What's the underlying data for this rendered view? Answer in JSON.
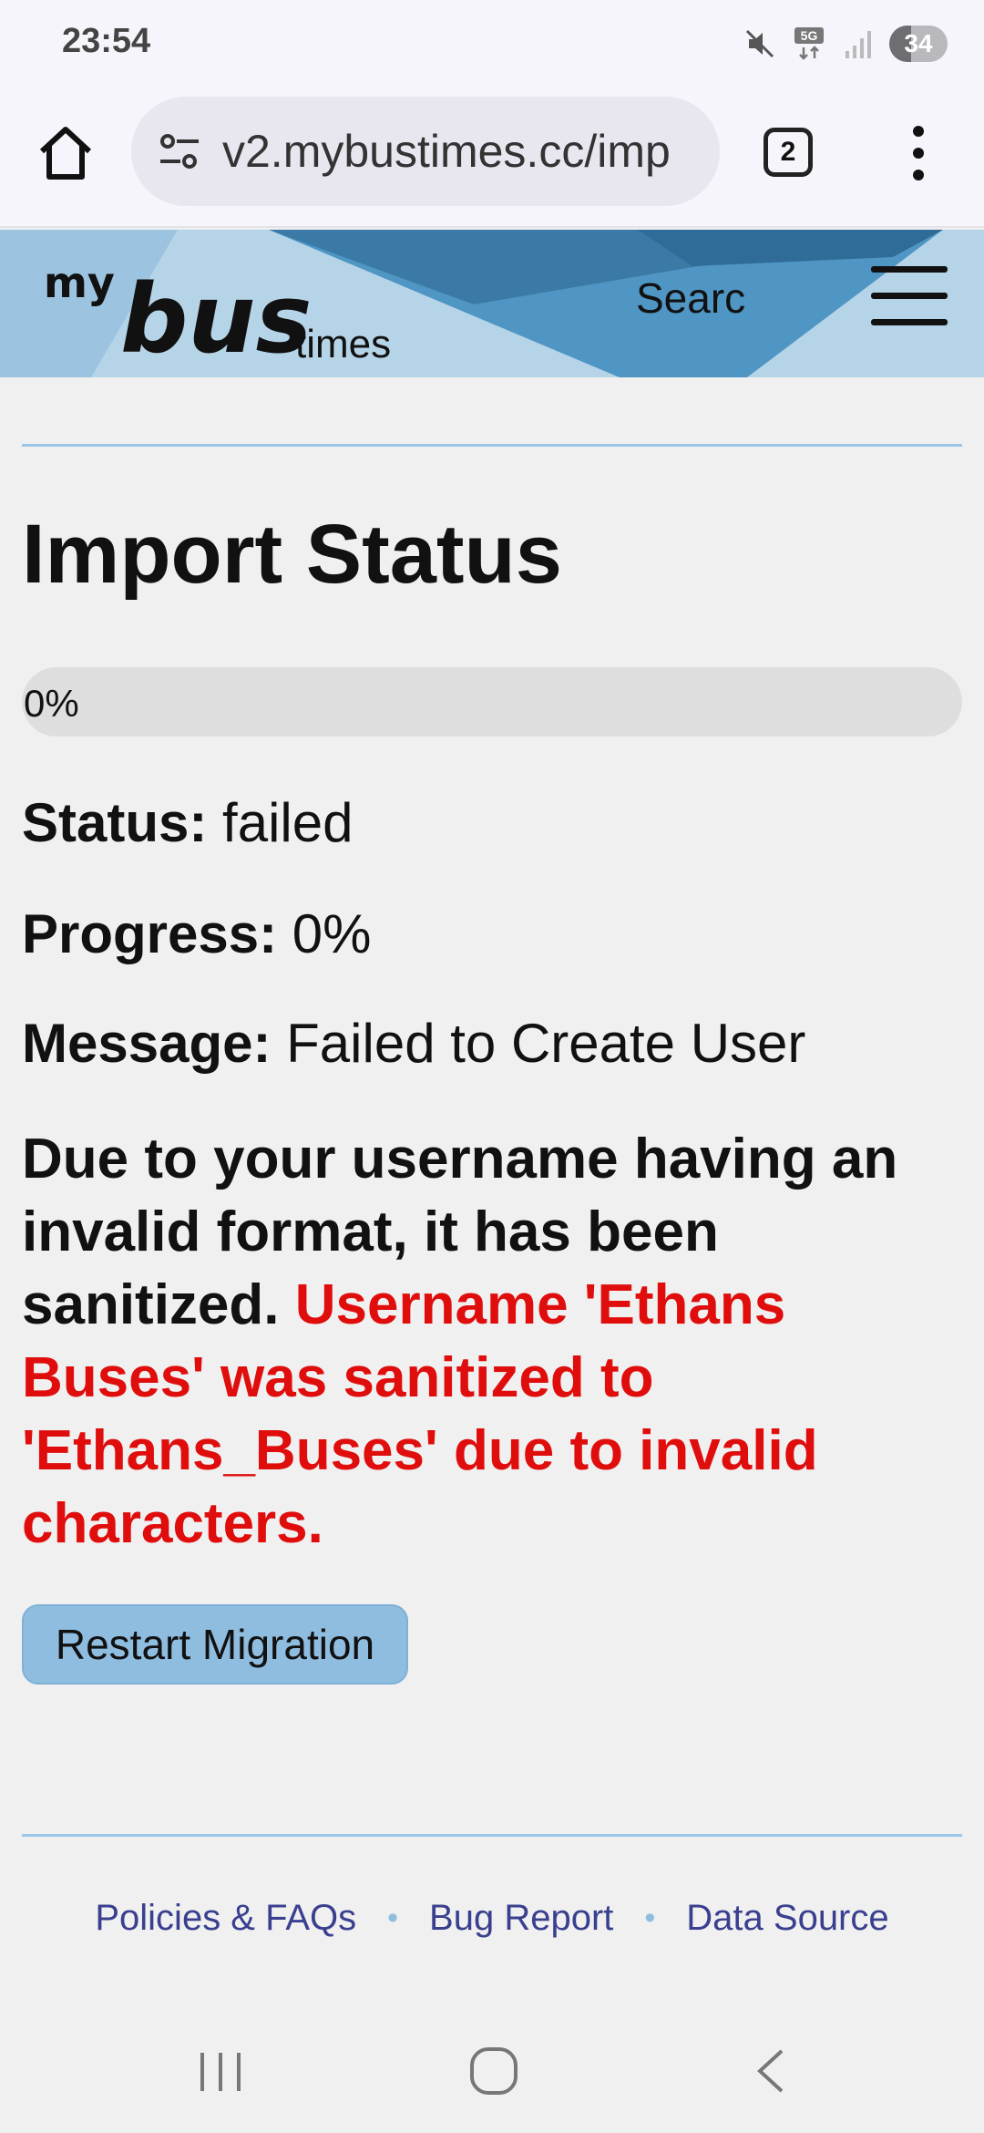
{
  "status_bar": {
    "time": "23:54",
    "battery": "34",
    "icons": [
      "mute-icon",
      "5g-signal-icon",
      "cell-signal-icon",
      "battery-icon"
    ]
  },
  "browser": {
    "url": "v2.mybustimes.cc/imp",
    "tab_count": "2",
    "icons": [
      "home-icon",
      "site-settings-icon",
      "tabs-icon",
      "more-vert-icon"
    ]
  },
  "site_header": {
    "logo_alt": "my bus times",
    "search_label": "Searc",
    "menu_icon": "hamburger-icon"
  },
  "main": {
    "title": "Import Status",
    "progress": {
      "percent": 0,
      "label": "0%"
    },
    "status_label": "Status:",
    "status_value": "failed",
    "progress_label": "Progress:",
    "progress_value": "0%",
    "message_label": "Message:",
    "message_value": "Failed to Create User",
    "notice": "Due to your username having an invalid format, it has been sanitized.",
    "warning": "Username 'Ethans Buses' was sanitized to 'Ethans_Buses' due to invalid characters.",
    "restart_button": "Restart Migration"
  },
  "footer": {
    "links": [
      "Policies & FAQs",
      "Bug Report",
      "Data Source"
    ],
    "separator": "•"
  },
  "colors": {
    "accent": "#9cc6e8",
    "button": "#8fbde0",
    "warning": "#e00d0d",
    "link": "#3a3f8f",
    "header_dark": "#3b7aa6"
  }
}
